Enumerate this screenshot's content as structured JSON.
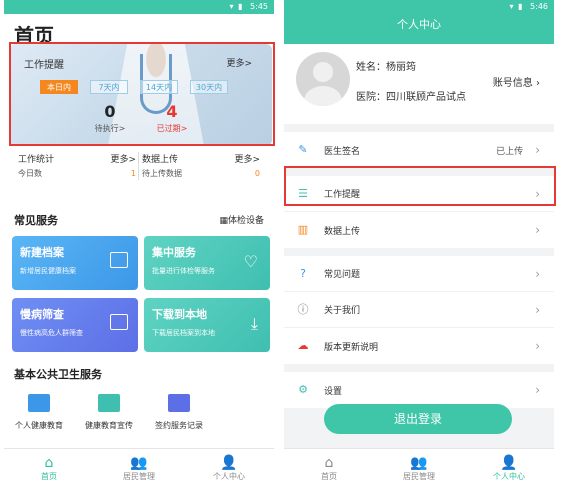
{
  "left": {
    "status_time": "5:45",
    "page_title": "首页",
    "reminder": {
      "title": "工作提醒",
      "more": "更多>",
      "tabs": [
        "本日内",
        "7天内",
        "14天内",
        "30天内"
      ],
      "pending_count": "0",
      "pending_label": "待执行>",
      "overdue_count": "4",
      "overdue_label": "已过期>"
    },
    "stats": {
      "work_title": "工作统计",
      "work_more": "更多>",
      "work_row_label": "今日数",
      "work_row_value": "1",
      "upload_title": "数据上传",
      "upload_more": "更多>",
      "upload_row_label": "待上传数据",
      "upload_row_value": "0"
    },
    "common_services": "常见服务",
    "device": "体检设备",
    "cards": [
      {
        "title": "新建档案",
        "sub": "新增居民健康档案"
      },
      {
        "title": "集中服务",
        "sub": "批量进行体检等服务"
      },
      {
        "title": "慢病筛查",
        "sub": "慢性病高危人群筛查"
      },
      {
        "title": "下载到本地",
        "sub": "下载居民档案到本地"
      }
    ],
    "public_health": "基本公共卫生服务",
    "services": [
      "个人健康教育",
      "健康教育宣传",
      "签约服务记录"
    ],
    "tabbar": [
      "首页",
      "居民管理",
      "个人中心"
    ],
    "colors": {
      "accent": "#3fc6a8",
      "orange": "#f5871f",
      "red": "#e53935"
    }
  },
  "right": {
    "status_time": "5:46",
    "header": "个人中心",
    "name": "姓名：杨丽筠",
    "hospital": "医院：四川联顾产品试点",
    "account_info": "账号信息",
    "menu": [
      {
        "icon": "pen-icon",
        "label": "医生签名",
        "value": "已上传"
      },
      {
        "icon": "list-icon",
        "label": "工作提醒",
        "value": ""
      },
      {
        "icon": "bar-chart-icon",
        "label": "数据上传",
        "value": ""
      },
      {
        "icon": "question-icon",
        "label": "常见问题",
        "value": ""
      },
      {
        "icon": "info-icon",
        "label": "关于我们",
        "value": ""
      },
      {
        "icon": "update-icon",
        "label": "版本更新说明",
        "value": ""
      },
      {
        "icon": "gear-icon",
        "label": "设置",
        "value": ""
      }
    ],
    "logout": "退出登录",
    "tabbar": [
      "首页",
      "居民管理",
      "个人中心"
    ]
  }
}
